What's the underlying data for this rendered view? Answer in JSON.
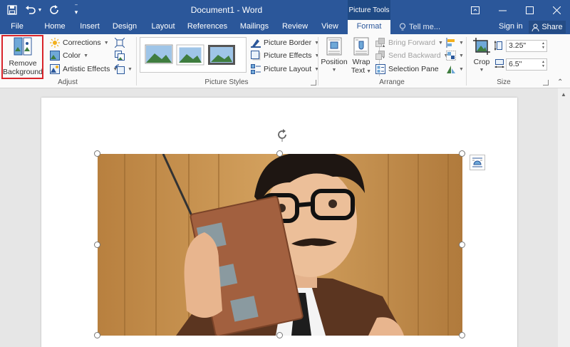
{
  "window": {
    "title": "Document1 - Word",
    "context_tab_group": "Picture Tools"
  },
  "quick_access": {
    "icons": [
      "save-icon",
      "undo-icon",
      "redo-icon",
      "customize-qat-icon"
    ]
  },
  "tabs": [
    {
      "label": "File"
    },
    {
      "label": "Home"
    },
    {
      "label": "Insert"
    },
    {
      "label": "Design"
    },
    {
      "label": "Layout"
    },
    {
      "label": "References"
    },
    {
      "label": "Mailings"
    },
    {
      "label": "Review"
    },
    {
      "label": "View"
    },
    {
      "label": "Format",
      "active": true
    }
  ],
  "tell_me": "Tell me...",
  "sign_in": "Sign in",
  "share": "Share",
  "ribbon": {
    "adjust": {
      "label": "Adjust",
      "remove_background": "Remove Background",
      "remove_background_line1": "Remove",
      "remove_background_line2": "Background",
      "corrections": "Corrections",
      "color": "Color",
      "artistic_effects": "Artistic Effects"
    },
    "picture_styles": {
      "label": "Picture Styles",
      "picture_border": "Picture Border",
      "picture_effects": "Picture Effects",
      "picture_layout": "Picture Layout"
    },
    "arrange": {
      "label": "Arrange",
      "position": "Position",
      "wrap_text_line1": "Wrap",
      "wrap_text_line2": "Text",
      "bring_forward": "Bring Forward",
      "send_backward": "Send Backward",
      "selection_pane": "Selection Pane"
    },
    "size": {
      "label": "Size",
      "crop": "Crop",
      "height": "3.25\"",
      "width": "6.5\""
    }
  },
  "colors": {
    "brand": "#2b579a",
    "highlight": "#d9242a"
  }
}
